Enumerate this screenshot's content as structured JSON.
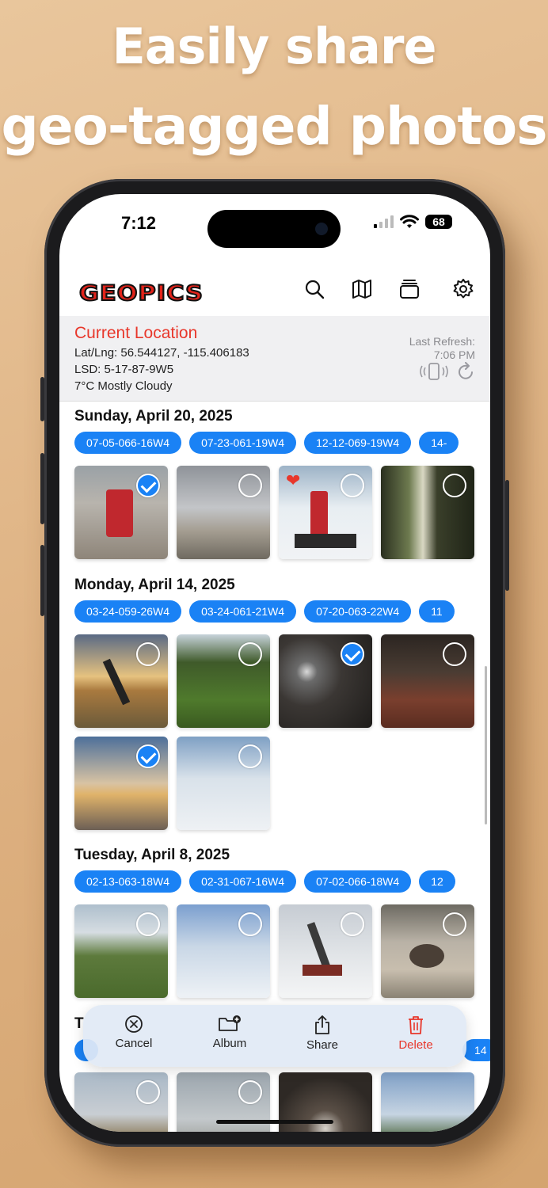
{
  "headline": {
    "line1": "Easily share",
    "line2": "geo-tagged photos"
  },
  "status_bar": {
    "time": "7:12",
    "battery": "68"
  },
  "app": {
    "logo": "GEOPICS"
  },
  "location": {
    "title": "Current Location",
    "latlng": "Lat/Lng: 56.544127, -115.406183",
    "lsd": "LSD: 5-17-87-9W5",
    "weather": "7°C Mostly Cloudy",
    "refresh_label": "Last Refresh:",
    "refresh_time": "7:06 PM"
  },
  "sections": [
    {
      "date": "Sunday, April 20, 2025",
      "chips": [
        "07-05-066-16W4",
        "07-23-061-19W4",
        "12-12-069-19W4",
        "14-"
      ]
    },
    {
      "date": "Monday, April 14, 2025",
      "chips": [
        "03-24-059-26W4",
        "03-24-061-21W4",
        "07-20-063-22W4",
        "11"
      ]
    },
    {
      "date": "Tuesday, April 8, 2025",
      "chips": [
        "02-13-063-18W4",
        "02-31-067-16W4",
        "07-02-066-18W4",
        "12"
      ]
    },
    {
      "date": "T",
      "chips": [
        "",
        "14"
      ]
    }
  ],
  "toolbar": {
    "cancel": "Cancel",
    "album": "Album",
    "share": "Share",
    "delete": "Delete"
  },
  "colors": {
    "accent": "#1a82f5",
    "brand_red": "#e2231a",
    "delete_red": "#e8372b"
  }
}
